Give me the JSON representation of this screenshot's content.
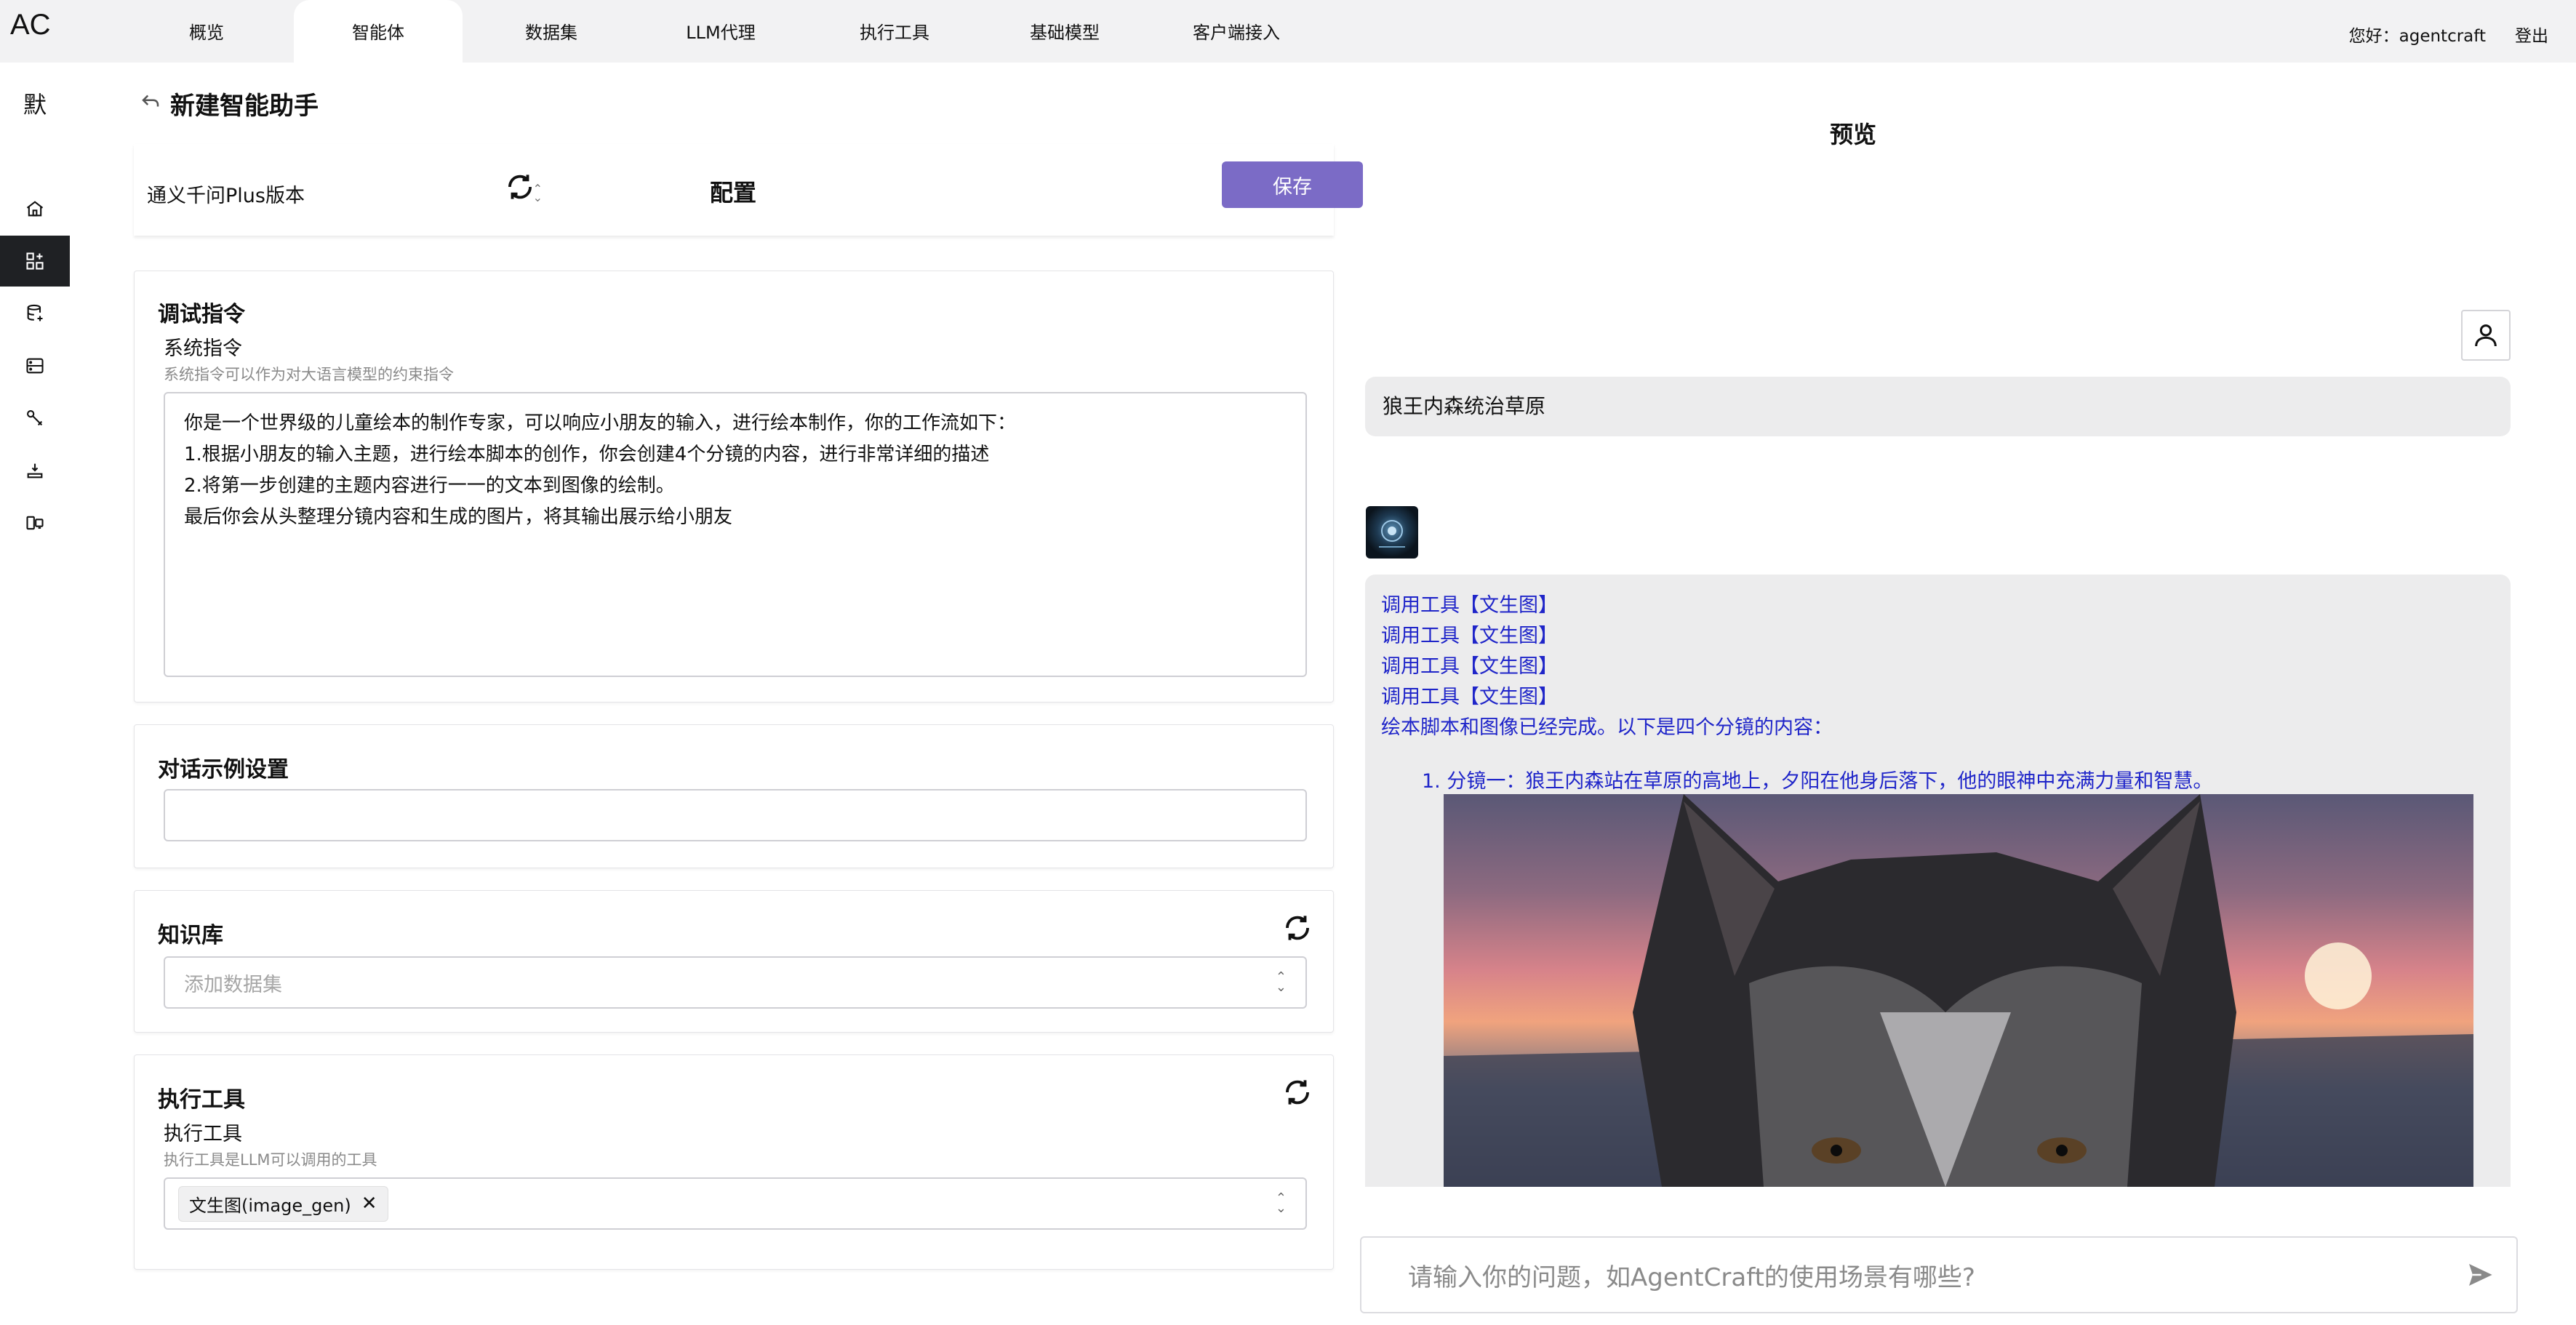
{
  "app": {
    "logo": "AC"
  },
  "nav": {
    "tabs": [
      {
        "label": "概览"
      },
      {
        "label": "智能体"
      },
      {
        "label": "数据集"
      },
      {
        "label": "LLM代理"
      },
      {
        "label": "执行工具"
      },
      {
        "label": "基础模型"
      },
      {
        "label": "客户端接入"
      }
    ],
    "active_tab": "智能体",
    "user_greeting": "您好：agentcraft",
    "logout_label": "登出"
  },
  "sidebar": {
    "avatar_text": "默",
    "icons": [
      "home-icon",
      "apps-icon",
      "dataset-icon",
      "storage-icon",
      "tool-icon",
      "model-icon",
      "client-icon"
    ],
    "active_index": 1
  },
  "page": {
    "title": "新建智能助手",
    "back_icon": "back-icon"
  },
  "config": {
    "model_value": "通义千问Plus版本",
    "title": "配置",
    "save_label": "保存",
    "instructions": {
      "title": "调试指令",
      "label": "系统指令",
      "hint": "系统指令可以作为对大语言模型的约束指令",
      "lines": [
        "你是一个世界级的儿童绘本的制作专家，可以响应小朋友的输入，进行绘本制作，你的工作流如下：",
        "1.根据小朋友的输入主题，进行绘本脚本的创作，你会创建4个分镜的内容，进行非常详细的描述",
        "2.将第一步创建的主题内容进行一一的文本到图像的绘制。",
        "最后你会从头整理分镜内容和生成的图片，将其输出展示给小朋友"
      ]
    },
    "dialog_examples": {
      "title": "对话示例设置",
      "value": ""
    },
    "knowledge": {
      "title": "知识库",
      "placeholder": "添加数据集"
    },
    "tools": {
      "title": "执行工具",
      "label": "执行工具",
      "hint": "执行工具是LLM可以调用的工具",
      "selected": [
        "文生图(image_gen)"
      ]
    }
  },
  "preview": {
    "title": "预览",
    "user_message": "狼王内森统治草原",
    "bot_lines": [
      "调用工具【文生图】",
      "调用工具【文生图】",
      "调用工具【文生图】",
      "调用工具【文生图】",
      "绘本脚本和图像已经完成。以下是四个分镜的内容："
    ],
    "storyboard_item": "1. 分镜一：狼王内森站在草原的高地上，夕阳在他身后落下，他的眼神中充满力量和智慧。",
    "chat_placeholder": "请输入你的问题，如AgentCraft的使用场景有哪些?"
  },
  "colors": {
    "accent": "#7b6bc6",
    "bot_text": "#1f25c9",
    "sidebar_active": "#1f2124"
  }
}
